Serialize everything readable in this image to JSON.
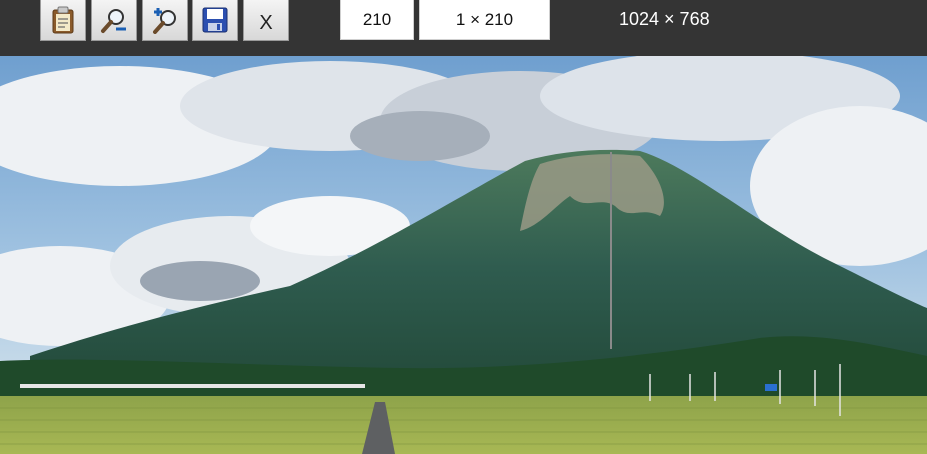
{
  "toolbar": {
    "buttons": [
      {
        "icon": "clipboard-icon",
        "label": ""
      },
      {
        "icon": "zoom-out-icon",
        "label": ""
      },
      {
        "icon": "zoom-in-icon",
        "label": ""
      },
      {
        "icon": "floppy-disk-save-icon",
        "label": ""
      },
      {
        "icon": "close-icon",
        "label": "X"
      }
    ],
    "length_value": "210",
    "selection_size": "1 × 210",
    "image_dimensions": "1024 × 768"
  },
  "colors": {
    "toolbar_bg": "#343434",
    "selection_line": "#8a8a8a"
  }
}
